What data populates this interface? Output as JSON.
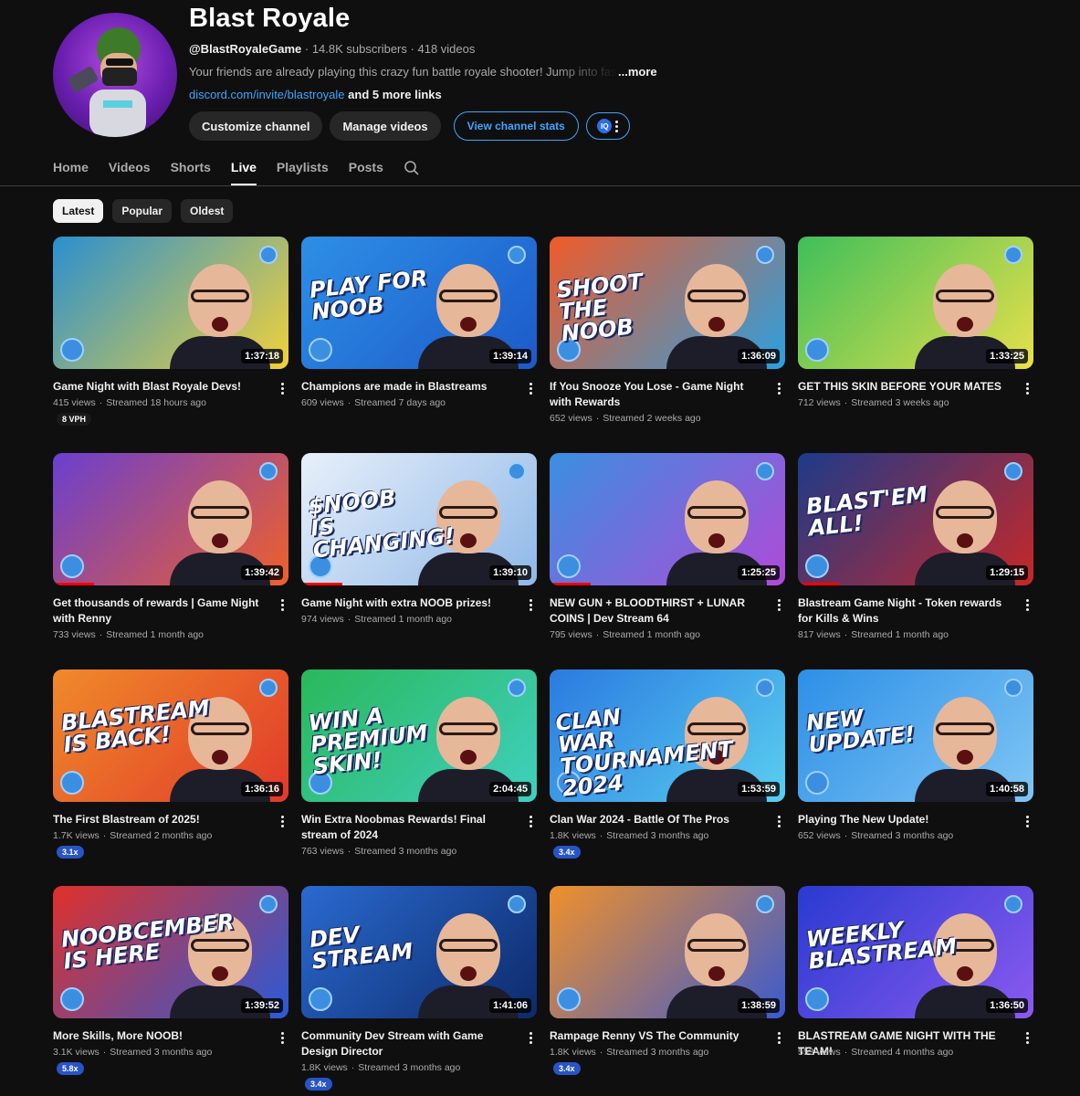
{
  "channel": {
    "name": "Blast Royale",
    "handle": "@BlastRoyaleGame",
    "subscribers": "14.8K subscribers",
    "videos": "418 videos",
    "description": "Your friends are already playing this crazy fun battle royale shooter! Jump into fast-paced",
    "more": "...more",
    "link": "discord.com/invite/blastroyale",
    "more_links": "and 5 more links",
    "separator": "·"
  },
  "buttons": {
    "customize": "Customize channel",
    "manage": "Manage videos",
    "stats": "View channel stats",
    "ext_label": "IQ"
  },
  "tabs": [
    "Home",
    "Videos",
    "Shorts",
    "Live",
    "Playlists",
    "Posts"
  ],
  "active_tab": "Live",
  "chips": [
    "Latest",
    "Popular",
    "Oldest"
  ],
  "active_chip": "Latest",
  "videos": [
    {
      "title": "Game Night with Blast Royale Devs!",
      "views": "415 views",
      "when": "Streamed 18 hours ago",
      "duration": "1:37:18",
      "badge": "8 VPH",
      "badge_color": "dark",
      "bg": "#2a8fd0",
      "bg2": "#f1d23a",
      "caption": ""
    },
    {
      "title": "Champions are made in Blastreams",
      "views": "609 views",
      "when": "Streamed 7 days ago",
      "duration": "1:39:14",
      "badge": "",
      "bg": "#2d8fe6",
      "bg2": "#1c5ac9",
      "caption": "PLAY FOR NOOB"
    },
    {
      "title": "If You Snooze You Lose - Game Night with Rewards",
      "views": "652 views",
      "when": "Streamed 2 weeks ago",
      "duration": "1:36:09",
      "badge": "",
      "bg": "#f05a28",
      "bg2": "#2aa0e0",
      "caption": "SHOOT THE NOOB"
    },
    {
      "title": "GET THIS SKIN BEFORE YOUR MATES",
      "views": "712 views",
      "when": "Streamed 3 weeks ago",
      "duration": "1:33:25",
      "badge": "",
      "bg": "#3fbf5a",
      "bg2": "#e8e04a",
      "caption": ""
    },
    {
      "title": "Get thousands of rewards | Game Night with Renny",
      "views": "733 views",
      "when": "Streamed 1 month ago",
      "duration": "1:39:42",
      "badge": "",
      "bg": "#6a3fd0",
      "bg2": "#f0602a",
      "caption": ""
    },
    {
      "title": "Game Night with extra NOOB prizes!",
      "views": "974 views",
      "when": "Streamed 1 month ago",
      "duration": "1:39:10",
      "badge": "",
      "bg": "#e8f0fa",
      "bg2": "#8fb8e8",
      "caption": "$NOOB IS CHANGING!"
    },
    {
      "title": "NEW GUN + BLOODTHIRST + LUNAR COINS | Dev Stream 64",
      "views": "795 views",
      "when": "Streamed 1 month ago",
      "duration": "1:25:25",
      "badge": "",
      "bg": "#3a8fe0",
      "bg2": "#b04ad8",
      "caption": ""
    },
    {
      "title": "Blastream Game Night - Token rewards for Kills & Wins",
      "views": "817 views",
      "when": "Streamed 1 month ago",
      "duration": "1:29:15",
      "badge": "",
      "bg": "#1d3a8a",
      "bg2": "#c62828",
      "caption": "BLAST'EM ALL!"
    },
    {
      "title": "The First Blastream of 2025!",
      "views": "1.7K views",
      "when": "Streamed 2 months ago",
      "duration": "1:36:16",
      "badge": "3.1x",
      "badge_color": "blue",
      "bg": "#f08a2a",
      "bg2": "#e03a2a",
      "caption": "BLASTREAM IS BACK!"
    },
    {
      "title": "Win Extra Noobmas Rewards! Final stream of 2024",
      "views": "763 views",
      "when": "Streamed 3 months ago",
      "duration": "2:04:45",
      "badge": "",
      "bg": "#2ab85a",
      "bg2": "#3fd0c0",
      "caption": "WIN A PREMIUM SKIN!"
    },
    {
      "title": "Clan War 2024 - Battle Of The Pros",
      "views": "1.8K views",
      "when": "Streamed 3 months ago",
      "duration": "1:53:59",
      "badge": "3.4x",
      "badge_color": "blue",
      "bg": "#2a7ae0",
      "bg2": "#5acff0",
      "caption": "CLAN WAR TOURNAMENT 2024"
    },
    {
      "title": "Playing The New Update!",
      "views": "652 views",
      "when": "Streamed 3 months ago",
      "duration": "1:40:58",
      "badge": "",
      "bg": "#2d8fe6",
      "bg2": "#7fc6f5",
      "caption": "NEW UPDATE!"
    },
    {
      "title": "More Skills, More NOOB!",
      "views": "3.1K views",
      "when": "Streamed 3 months ago",
      "duration": "1:39:52",
      "badge": "5.8x",
      "badge_color": "blue",
      "bg": "#e0302a",
      "bg2": "#2a5ad8",
      "caption": "NOOBCEMBER IS HERE"
    },
    {
      "title": "Community Dev Stream with Game Design Director",
      "views": "1.8K views",
      "when": "Streamed 3 months ago",
      "duration": "1:41:06",
      "badge": "3.4x",
      "badge_color": "blue",
      "bg": "#2a6ad0",
      "bg2": "#0d2a6a",
      "caption": "DEV STREAM"
    },
    {
      "title": "Rampage Renny VS The Community",
      "views": "1.8K views",
      "when": "Streamed 3 months ago",
      "duration": "1:38:59",
      "badge": "3.4x",
      "badge_color": "blue",
      "bg": "#f0902a",
      "bg2": "#3a5ad0",
      "caption": ""
    },
    {
      "title": "BLASTREAM GAME NIGHT WITH THE TEAM!",
      "views": "553 views",
      "when": "Streamed 4 months ago",
      "duration": "1:36:50",
      "badge": "",
      "bg": "#2a3ad0",
      "bg2": "#8a5af0",
      "caption": "WEEKLY BLASTREAM"
    }
  ]
}
